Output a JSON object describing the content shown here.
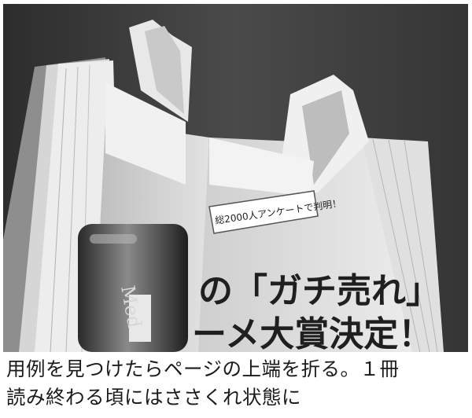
{
  "photo": {
    "banner_text": "総2000人アンケートで判明！",
    "headline_line1": "の「ガチ売れ」",
    "headline_line2": "ーメ大賞決定！",
    "bottle_text": "Med"
  },
  "caption": {
    "line1": "用例を見つけたらページの上端を折る。１冊",
    "line2": "読み終わる頃にはささくれ状態に"
  }
}
